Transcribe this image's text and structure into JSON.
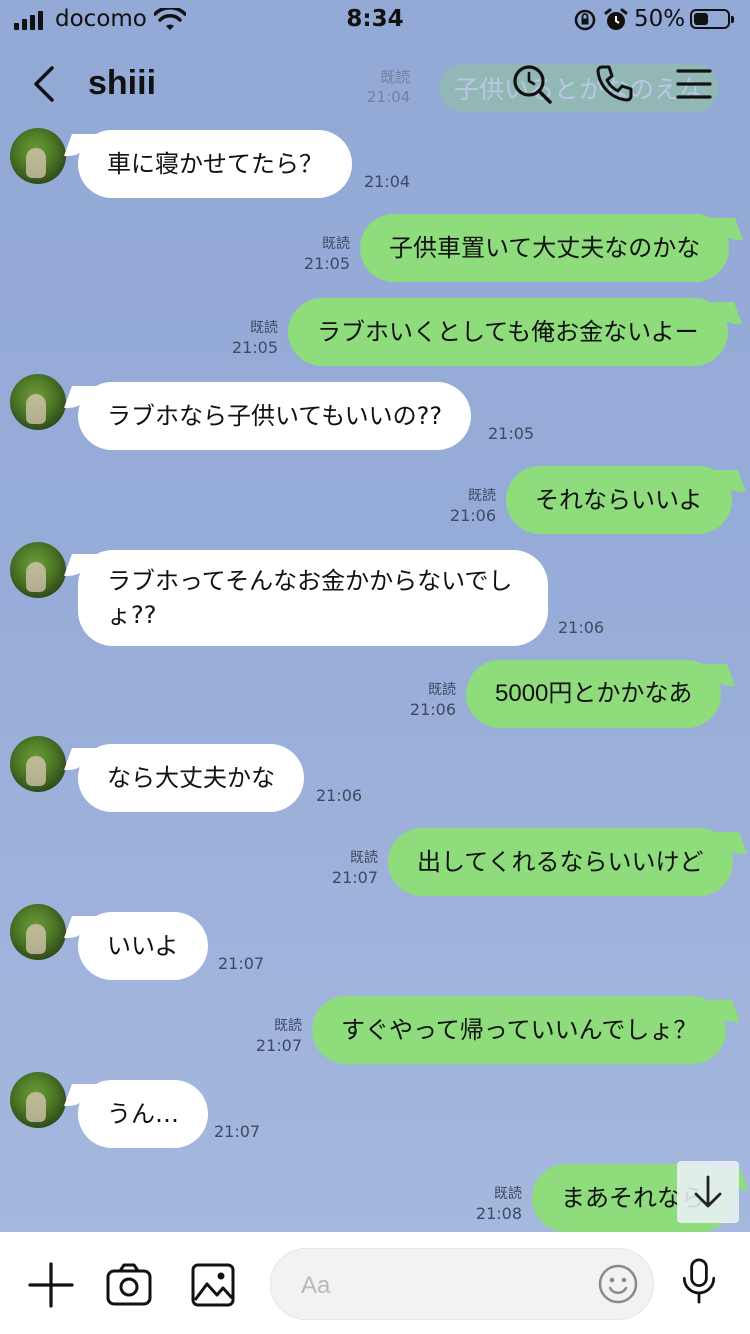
{
  "status_bar": {
    "carrier": "docomo",
    "time": "8:34",
    "battery_percent": "50%",
    "battery_level": 0.5
  },
  "header": {
    "title": "shiii"
  },
  "ghost_overlay": {
    "read": "既読",
    "time": "21:04",
    "text": "子供いるとかなのえな"
  },
  "messages": [
    {
      "side": "left",
      "text": "車に寝かせてたら？",
      "time": "21:04"
    },
    {
      "side": "right",
      "text": "子供車置いて大丈夫なのかな",
      "read": "既読",
      "time": "21:05"
    },
    {
      "side": "right",
      "text": "ラブホいくとしても俺お金ないよー",
      "read": "既読",
      "time": "21:05"
    },
    {
      "side": "left",
      "text": "ラブホなら子供いてもいいの??",
      "time": "21:05"
    },
    {
      "side": "right",
      "text": "それならいいよ",
      "read": "既読",
      "time": "21:06"
    },
    {
      "side": "left",
      "text": "ラブホってそんなお金かからないでしょ??",
      "time": "21:06"
    },
    {
      "side": "right",
      "text": "5000円とかかなあ",
      "read": "既読",
      "time": "21:06"
    },
    {
      "side": "left",
      "text": "なら大丈夫かな",
      "time": "21:06"
    },
    {
      "side": "right",
      "text": "出してくれるならいいけど",
      "read": "既読",
      "time": "21:07"
    },
    {
      "side": "left",
      "text": "いいよ",
      "time": "21:07"
    },
    {
      "side": "right",
      "text": "すぐやって帰っていいんでしょ？",
      "read": "既読",
      "time": "21:07"
    },
    {
      "side": "left",
      "text": "うん…",
      "time": "21:07"
    },
    {
      "side": "right",
      "text": "まあそれなら",
      "read": "既読",
      "time": "21:08"
    }
  ],
  "input": {
    "placeholder": "Aa",
    "value": ""
  },
  "icons": {
    "back": "chevron-left-icon",
    "search": "search-icon",
    "call": "phone-icon",
    "menu": "menu-icon",
    "add": "plus-icon",
    "camera": "camera-icon",
    "image": "image-icon",
    "emoji": "emoji-icon",
    "mic": "microphone-icon",
    "scroll": "arrow-down-icon"
  },
  "colors": {
    "background": "#93a9d6",
    "my_bubble": "#8fdc7c",
    "their_bubble": "#ffffff"
  }
}
